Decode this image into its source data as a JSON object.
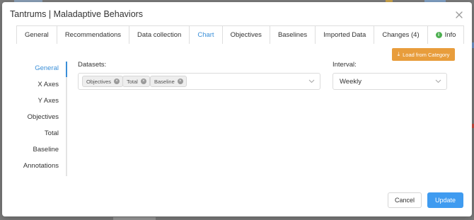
{
  "modal": {
    "title": "Tantrums | Maladaptive Behaviors",
    "close_icon": "close-icon"
  },
  "tabs": [
    {
      "label": "General",
      "active": false
    },
    {
      "label": "Recommendations",
      "active": false
    },
    {
      "label": "Data collection",
      "active": false
    },
    {
      "label": "Chart",
      "active": true
    },
    {
      "label": "Objectives",
      "active": false
    },
    {
      "label": "Baselines",
      "active": false
    },
    {
      "label": "Imported Data",
      "active": false
    },
    {
      "label": "Changes (4)",
      "active": false
    },
    {
      "label": "Info",
      "active": false,
      "icon": "info-icon"
    }
  ],
  "load_button": {
    "label": "Load from Category",
    "icon": "download-icon"
  },
  "side_nav": [
    {
      "label": "General",
      "active": true
    },
    {
      "label": "X Axes",
      "active": false
    },
    {
      "label": "Y Axes",
      "active": false
    },
    {
      "label": "Objectives",
      "active": false
    },
    {
      "label": "Total",
      "active": false
    },
    {
      "label": "Baseline",
      "active": false
    },
    {
      "label": "Annotations",
      "active": false
    }
  ],
  "datasets": {
    "label": "Datasets:",
    "selected": [
      "Objectives",
      "Total",
      "Baseline"
    ]
  },
  "interval": {
    "label": "Interval:",
    "value": "Weekly"
  },
  "footer": {
    "cancel_label": "Cancel",
    "update_label": "Update"
  },
  "colors": {
    "accent": "#3a8fd8",
    "primary_button": "#3f9bf0",
    "load_button": "#e89d3c",
    "info_icon": "#4caf50"
  }
}
